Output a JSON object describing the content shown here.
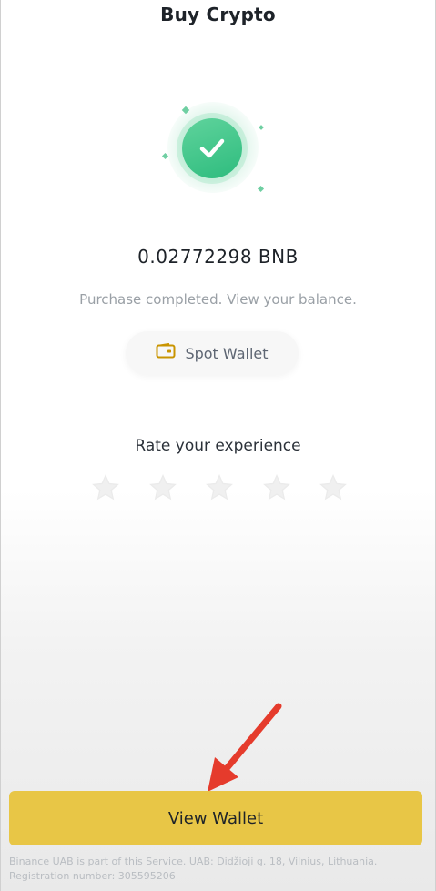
{
  "header": {
    "title": "Buy Crypto"
  },
  "status": {
    "icon": "check-circle-icon",
    "amount": "0.02772298 BNB",
    "message": "Purchase completed. View your balance."
  },
  "spot_wallet": {
    "icon": "wallet-icon",
    "label": "Spot Wallet"
  },
  "rating": {
    "label": "Rate your experience",
    "star_icon": "star-icon",
    "max": 5,
    "value": 0
  },
  "actions": {
    "view_wallet_label": "View Wallet"
  },
  "footer": {
    "line1": "Binance UAB is part of this Service. UAB: Didžioji g. 18, Vilnius, Lithuania.",
    "line2": "Registration number: 305595206"
  },
  "colors": {
    "success": "#2ebc7e",
    "accent": "#e8c646",
    "wallet_icon": "#c99400",
    "annotation_arrow": "#e53b2c"
  }
}
